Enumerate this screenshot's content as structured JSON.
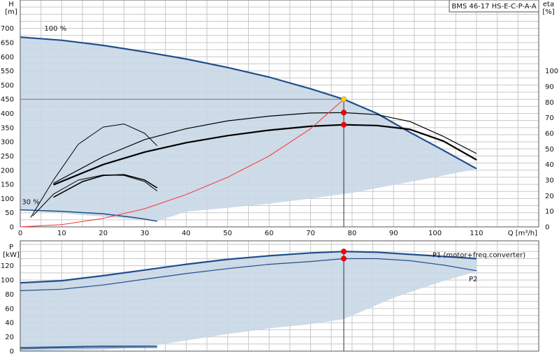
{
  "colors": {
    "envelope_fill": "#c9d7e5",
    "curve_dark": "#1f4e8c",
    "curve_black": "#000000",
    "system_curve": "#ff3030",
    "duty_point_yellow": "#ffd21a",
    "duty_marker": "#ff0000",
    "grid": "#c8c8c8"
  },
  "chart_data": [
    {
      "id": "qh",
      "type": "line",
      "title": "BMS 46-17 HS-E-C-P-A-A",
      "xlabel": "Q [m³/h]",
      "ylabel": "H\n[m]",
      "y2label": "eta\n[%]",
      "xlim": [
        0,
        125
      ],
      "ylim": [
        0,
        800
      ],
      "y2lim": [
        0,
        145.5
      ],
      "xticks": [
        0,
        10,
        20,
        30,
        40,
        50,
        60,
        70,
        80,
        90,
        100,
        110
      ],
      "yticks": [
        0,
        50,
        100,
        150,
        200,
        250,
        300,
        350,
        400,
        450,
        500,
        550,
        600,
        650,
        700
      ],
      "y2ticks": [
        0,
        10,
        20,
        30,
        40,
        50,
        60,
        70,
        80,
        90,
        100
      ],
      "grid": true,
      "annotations": [
        {
          "text": "100 %",
          "x": 5.8,
          "y": 692
        },
        {
          "text": "30 %",
          "x": 0.4,
          "y": 80
        }
      ],
      "envelope": {
        "upper": [
          [
            0,
            669
          ],
          [
            10,
            658
          ],
          [
            20,
            640
          ],
          [
            30,
            617
          ],
          [
            40,
            592
          ],
          [
            50,
            562
          ],
          [
            60,
            528
          ],
          [
            70,
            487
          ],
          [
            78,
            450
          ],
          [
            86,
            400
          ],
          [
            94,
            333
          ],
          [
            102,
            270
          ],
          [
            110,
            205
          ]
        ],
        "lower": [
          [
            110,
            205
          ],
          [
            100,
            175
          ],
          [
            90,
            148
          ],
          [
            80,
            120
          ],
          [
            70,
            100
          ],
          [
            60,
            82
          ],
          [
            50,
            67
          ],
          [
            40,
            54
          ],
          [
            33,
            20
          ],
          [
            33,
            20
          ],
          [
            0,
            60
          ]
        ]
      },
      "series": [
        {
          "id": "h100",
          "role": "head",
          "axis": "y",
          "color": "#1f4e8c",
          "width": 2.2,
          "points": [
            [
              0,
              669
            ],
            [
              10,
              658
            ],
            [
              20,
              640
            ],
            [
              30,
              617
            ],
            [
              40,
              592
            ],
            [
              50,
              562
            ],
            [
              60,
              528
            ],
            [
              70,
              487
            ],
            [
              78,
              450
            ],
            [
              86,
              400
            ],
            [
              94,
              333
            ],
            [
              102,
              270
            ],
            [
              110,
              205
            ]
          ]
        },
        {
          "id": "h30",
          "role": "head",
          "axis": "y",
          "color": "#1f4e8c",
          "width": 1.5,
          "points": [
            [
              0,
              60
            ],
            [
              10,
              55
            ],
            [
              20,
              46
            ],
            [
              28,
              32
            ],
            [
              33,
              20
            ]
          ]
        },
        {
          "id": "eta_big",
          "role": "efficiency",
          "axis": "y2",
          "color": "#000000",
          "width": 1.2,
          "points": [
            [
              8,
              28
            ],
            [
              20,
              45
            ],
            [
              30,
              56
            ],
            [
              40,
              63
            ],
            [
              50,
              68
            ],
            [
              60,
              71
            ],
            [
              70,
              73
            ],
            [
              78,
              73.3
            ],
            [
              86,
              72
            ],
            [
              94,
              67.5
            ],
            [
              102,
              58
            ],
            [
              110,
              47
            ]
          ]
        },
        {
          "id": "eta_total",
          "role": "efficiency",
          "axis": "y2",
          "color": "#000000",
          "width": 2.2,
          "points": [
            [
              8,
              27
            ],
            [
              20,
              40
            ],
            [
              30,
              48
            ],
            [
              40,
              54
            ],
            [
              50,
              58.5
            ],
            [
              60,
              62
            ],
            [
              70,
              64.5
            ],
            [
              78,
              65.5
            ],
            [
              86,
              65
            ],
            [
              94,
              62.5
            ],
            [
              102,
              55
            ],
            [
              110,
              43
            ]
          ]
        },
        {
          "id": "eta_small_a",
          "role": "efficiency",
          "axis": "y2",
          "color": "#000000",
          "width": 1.0,
          "points": [
            [
              2.5,
              6
            ],
            [
              8,
              30
            ],
            [
              14,
              53
            ],
            [
              20,
              64
            ],
            [
              25,
              66
            ],
            [
              30,
              60
            ],
            [
              33,
              52
            ]
          ]
        },
        {
          "id": "eta_small_b",
          "role": "efficiency",
          "axis": "y2",
          "color": "#000000",
          "width": 1.0,
          "points": [
            [
              3,
              7
            ],
            [
              8,
              21
            ],
            [
              14,
              30
            ],
            [
              20,
              33.3
            ],
            [
              25,
              33
            ],
            [
              30,
              29
            ],
            [
              33,
              23
            ]
          ]
        },
        {
          "id": "eta_small_c",
          "role": "efficiency",
          "axis": "y2",
          "color": "#000000",
          "width": 1.6,
          "points": [
            [
              8,
              19
            ],
            [
              15,
              29
            ],
            [
              20,
              33
            ],
            [
              25,
              33.5
            ],
            [
              30,
              30
            ],
            [
              33,
              25
            ]
          ]
        },
        {
          "id": "system",
          "role": "system",
          "axis": "y",
          "color": "#ff3030",
          "width": 1.0,
          "points": [
            [
              0,
              0
            ],
            [
              10,
              8
            ],
            [
              20,
              30
            ],
            [
              30,
              64
            ],
            [
              40,
              114
            ],
            [
              50,
              175
            ],
            [
              60,
              250
            ],
            [
              70,
              346
            ],
            [
              78,
              450
            ]
          ]
        }
      ],
      "duty": {
        "Q": 78,
        "H": 450,
        "vline": {
          "x": 78,
          "from": 0,
          "to": 450
        },
        "hline": {
          "y": 450,
          "from": 0,
          "to": 78
        },
        "markers": [
          {
            "axis": "y",
            "x": 78,
            "y": 450,
            "color": "#ffd21a"
          },
          {
            "axis": "y2",
            "x": 78,
            "y": 73.3,
            "color": "#ff0000"
          },
          {
            "axis": "y2",
            "x": 78,
            "y": 65.5,
            "color": "#ff0000"
          }
        ]
      }
    },
    {
      "id": "power",
      "type": "line",
      "title": "",
      "xlabel": "",
      "ylabel": "P\n[kW]",
      "xlim": [
        0,
        125
      ],
      "ylim": [
        0,
        155
      ],
      "yticks": [
        0,
        20,
        40,
        60,
        80,
        100,
        120
      ],
      "grid": true,
      "envelope": {
        "upper": [
          [
            0,
            96
          ],
          [
            10,
            99
          ],
          [
            20,
            106
          ],
          [
            30,
            114
          ],
          [
            40,
            122
          ],
          [
            50,
            129
          ],
          [
            60,
            134
          ],
          [
            70,
            138
          ],
          [
            78,
            140
          ],
          [
            86,
            139
          ],
          [
            94,
            136
          ],
          [
            102,
            133
          ],
          [
            110,
            130
          ]
        ],
        "lower": [
          [
            110,
            112
          ],
          [
            100,
            95
          ],
          [
            90,
            75
          ],
          [
            78,
            45
          ],
          [
            70,
            38
          ],
          [
            60,
            32
          ],
          [
            50,
            24
          ],
          [
            40,
            15
          ],
          [
            30,
            6
          ],
          [
            20,
            2
          ],
          [
            10,
            1
          ],
          [
            0,
            0
          ]
        ]
      },
      "series": [
        {
          "id": "P1",
          "name": "P1 (motor+freq.converter)",
          "color": "#1f4e8c",
          "width": 2.2,
          "points": [
            [
              0,
              96
            ],
            [
              10,
              99
            ],
            [
              20,
              106
            ],
            [
              30,
              114
            ],
            [
              40,
              122
            ],
            [
              50,
              129
            ],
            [
              60,
              134
            ],
            [
              70,
              138
            ],
            [
              78,
              140
            ],
            [
              86,
              139
            ],
            [
              94,
              136
            ],
            [
              102,
              133
            ],
            [
              110,
              130
            ]
          ]
        },
        {
          "id": "P2",
          "name": "P2",
          "color": "#1f4e8c",
          "width": 1.2,
          "points": [
            [
              0,
              85
            ],
            [
              10,
              87
            ],
            [
              20,
              93
            ],
            [
              30,
              101
            ],
            [
              40,
              109
            ],
            [
              50,
              116
            ],
            [
              60,
              122
            ],
            [
              70,
              126
            ],
            [
              78,
              130
            ],
            [
              86,
              130
            ],
            [
              94,
              127
            ],
            [
              102,
              121
            ],
            [
              110,
              113
            ]
          ]
        },
        {
          "id": "P1_30",
          "color": "#1f4e8c",
          "width": 1.6,
          "points": [
            [
              0,
              5
            ],
            [
              10,
              6
            ],
            [
              20,
              7
            ],
            [
              33,
              7
            ]
          ]
        },
        {
          "id": "P2_30",
          "color": "#1f4e8c",
          "width": 1.0,
          "points": [
            [
              0,
              3
            ],
            [
              10,
              4.5
            ],
            [
              20,
              5
            ],
            [
              33,
              5
            ]
          ]
        }
      ],
      "duty": {
        "vline": {
          "x": 78,
          "from": 0,
          "to": 140
        },
        "markers": [
          {
            "x": 78,
            "y": 140,
            "color": "#ff0000"
          },
          {
            "x": 78,
            "y": 130,
            "color": "#ff0000"
          }
        ]
      }
    }
  ]
}
